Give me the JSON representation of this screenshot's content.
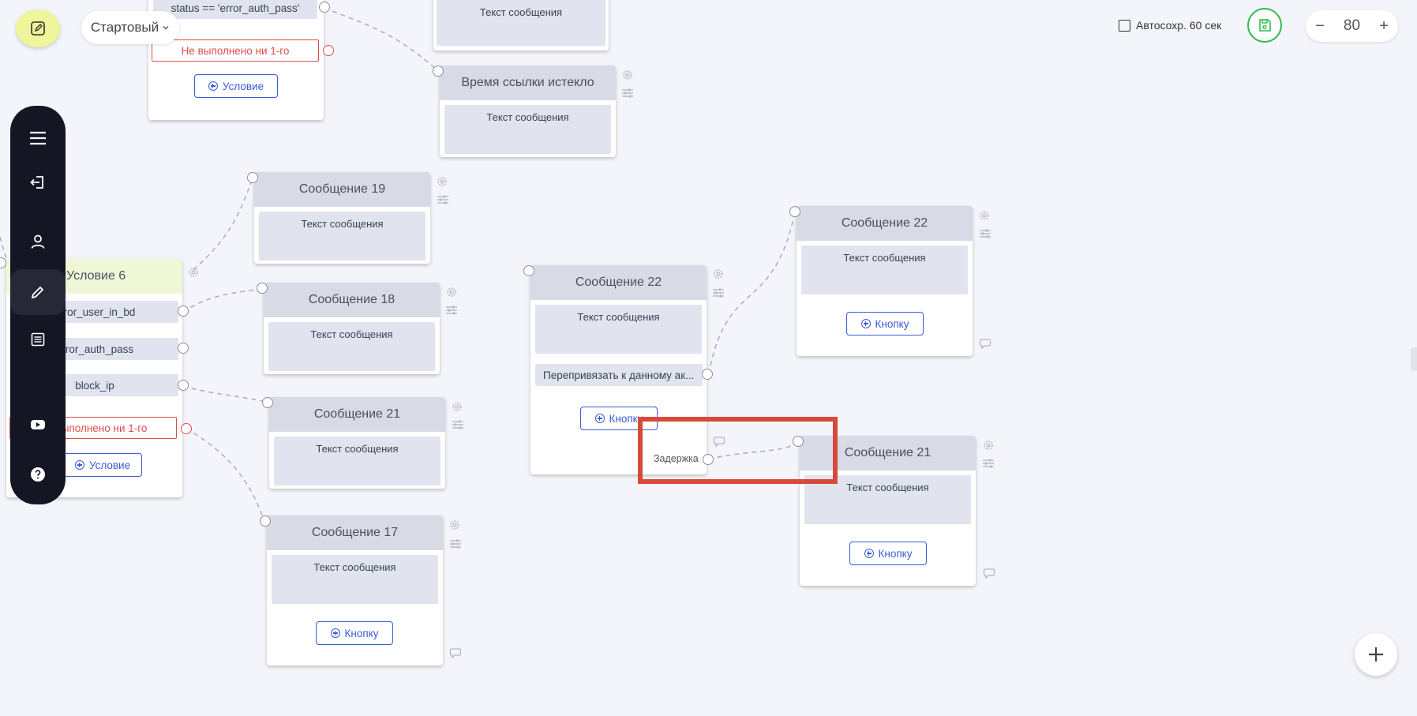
{
  "toolbar": {
    "mode_label": "Стартовый",
    "autosave_label": "Автосохр. 60 сек",
    "zoom_value": "80",
    "zoom_minus": "−",
    "zoom_plus": "+"
  },
  "sidebar": {
    "items": [
      "menu-icon",
      "logout-icon",
      "user-icon",
      "pencil-icon",
      "list-icon",
      "youtube-icon",
      "help-icon"
    ]
  },
  "nodes": {
    "top_condition": {
      "row_status": "status == 'error_auth_pass'",
      "not_done": "Не выполнено ни 1-го",
      "button": "Условие"
    },
    "top_msg": {
      "text": "Текст сообщения"
    },
    "expired": {
      "title": "Время ссылки истекло",
      "text": "Текст сообщения"
    },
    "cond6": {
      "title": "Условие 6",
      "row1": "error_user_in_bd",
      "row2": "error_auth_pass",
      "row3": "block_ip",
      "not_done": "Не выполнено ни 1-го",
      "button": "Условие"
    },
    "msg19": {
      "title": "Сообщение 19",
      "text": "Текст сообщения"
    },
    "msg18": {
      "title": "Сообщение 18",
      "text": "Текст сообщения"
    },
    "msg21a": {
      "title": "Сообщение 21",
      "text": "Текст сообщения"
    },
    "msg17": {
      "title": "Сообщение 17",
      "text": "Текст сообщения",
      "button": "Кнопку"
    },
    "msg22a": {
      "title": "Сообщение 22",
      "text": "Текст сообщения",
      "row": "Перепривязать к данному ак...",
      "button": "Кнопку",
      "delay": "Задержка"
    },
    "msg22b": {
      "title": "Сообщение 22",
      "text": "Текст сообщения",
      "button": "Кнопку"
    },
    "msg21b": {
      "title": "Сообщение 21",
      "text": "Текст сообщения",
      "button": "Кнопку"
    }
  },
  "colors": {
    "accent": "#3b5bd6",
    "danger": "#e04b4b",
    "save": "#2fbb4f",
    "highlight": "#d64a3b",
    "sidebar": "#151624"
  }
}
